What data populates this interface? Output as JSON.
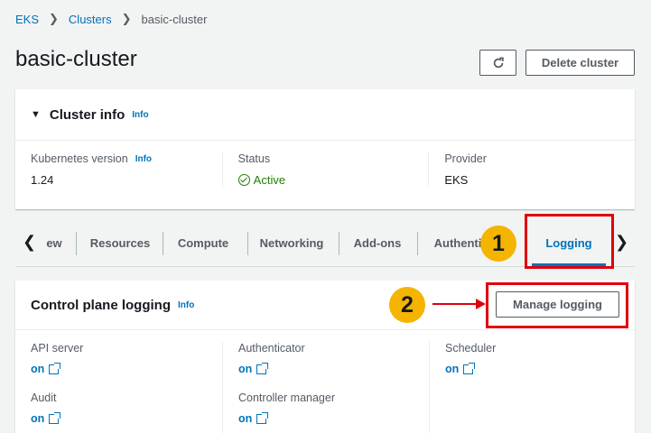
{
  "breadcrumb": {
    "items": [
      "EKS",
      "Clusters"
    ],
    "current": "basic-cluster"
  },
  "page": {
    "title": "basic-cluster"
  },
  "actions": {
    "delete_label": "Delete cluster"
  },
  "cluster_info": {
    "title": "Cluster info",
    "info": "Info",
    "kubernetes_label": "Kubernetes version",
    "kubernetes_info": "Info",
    "kubernetes_value": "1.24",
    "status_label": "Status",
    "status_value": "Active",
    "provider_label": "Provider",
    "provider_value": "EKS"
  },
  "tabs": [
    "ew",
    "Resources",
    "Compute",
    "Networking",
    "Add-ons",
    "Authenti",
    "Logging"
  ],
  "active_tab": "Logging",
  "logging": {
    "title": "Control plane logging",
    "info": "Info",
    "manage_label": "Manage logging",
    "items": [
      {
        "label": "API server",
        "value": "on"
      },
      {
        "label": "Audit",
        "value": "on"
      },
      {
        "label": "Authenticator",
        "value": "on"
      },
      {
        "label": "Controller manager",
        "value": "on"
      },
      {
        "label": "Scheduler",
        "value": "on"
      }
    ]
  },
  "annotations": {
    "step1": "1",
    "step2": "2",
    "color": "#e0000d",
    "badge_color": "#f4b400"
  },
  "colors": {
    "link": "#0073bb",
    "success": "#1d8102",
    "background": "#f2f3f3"
  }
}
